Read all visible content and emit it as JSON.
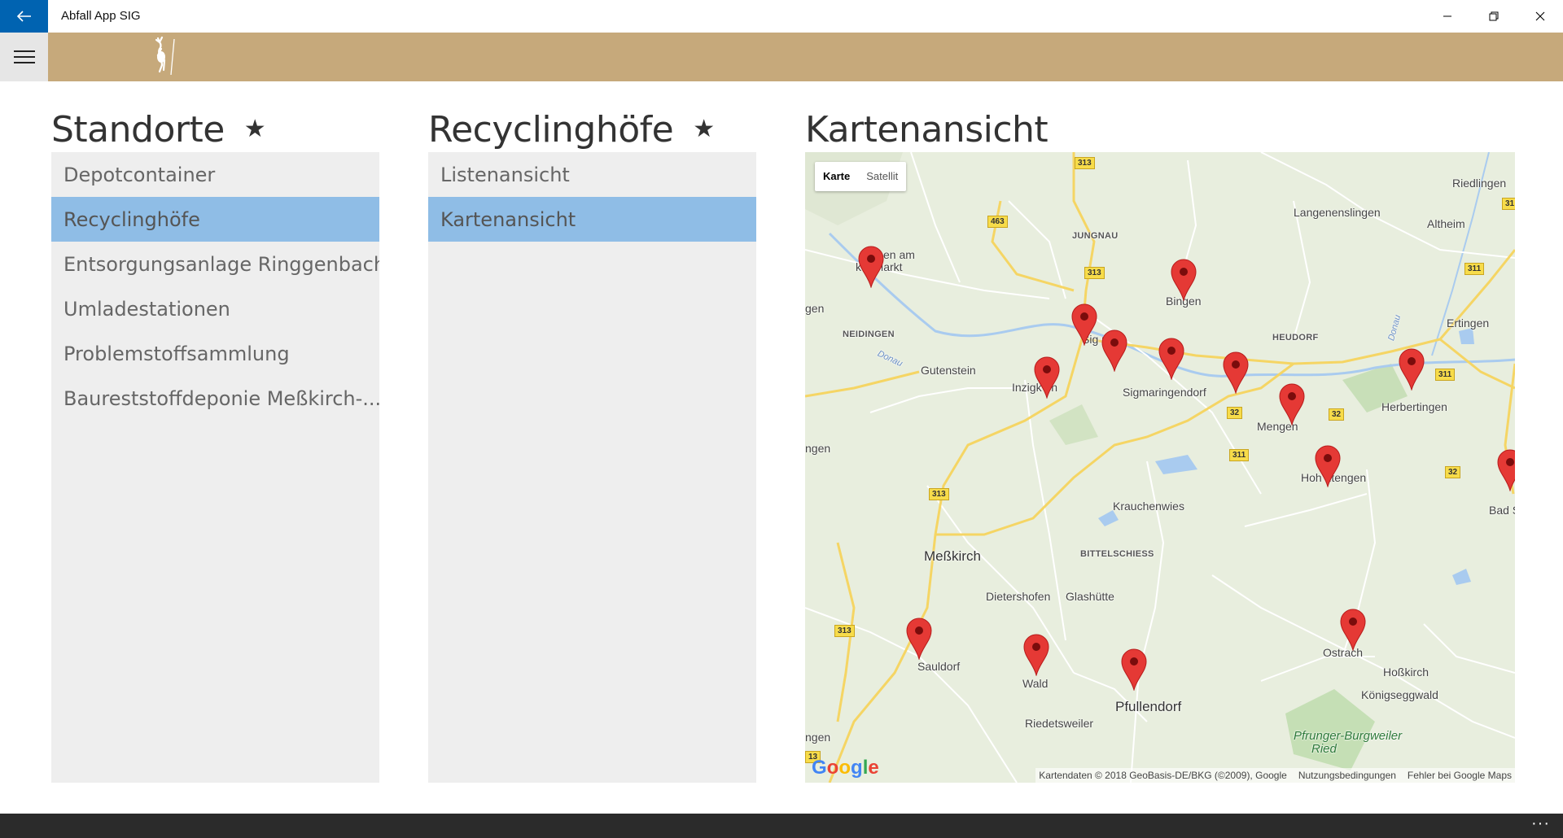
{
  "window": {
    "title": "Abfall App SIG",
    "accent": "#0063b1",
    "header_color": "#c6a97b"
  },
  "icons": {
    "back": "arrow-left-icon",
    "menu": "hamburger-icon",
    "minimize": "minimize-icon",
    "maximize": "restore-icon",
    "close": "close-icon",
    "more": "more-icon"
  },
  "columns": {
    "standorte": {
      "title": "Standorte",
      "star": "★",
      "items": [
        "Depotcontainer",
        "Recyclinghöfe",
        "Entsorgungsanlage Ringgenbach",
        "Umladestationen",
        "Problemstoffsammlung",
        "Baureststoffdeponie Meßkirch-..."
      ],
      "selected_index": 1
    },
    "recyclinghoefe": {
      "title": "Recyclinghöfe",
      "star": "★",
      "items": [
        "Listenansicht",
        "Kartenansicht"
      ],
      "selected_index": 1
    },
    "map": {
      "title": "Kartenansicht",
      "type_karte": "Karte",
      "type_satellit": "Satellit",
      "google": "Google",
      "attribution": "Kartendaten © 2018 GeoBasis-DE/BKG (©2009), Google",
      "terms": "Nutzungsbedingungen",
      "report": "Fehler bei Google Maps"
    }
  },
  "map_labels": {
    "riedlingen": "Riedlingen",
    "langenenslingen": "Langenenslingen",
    "altheim": "Altheim",
    "jungnau": "JUNGNAU",
    "bingen": "Bingen",
    "en_am": "en am",
    "k_markt": "k     n Markt",
    "gen1": "gen",
    "neidingen": "NEIDINGEN",
    "donau1": "Donau",
    "donau2": "Donau",
    "sigmaringen": "Sig    ngen",
    "heudorf": "HEUDORF",
    "ertingen": "Ertingen",
    "gutenstein": "Gutenstein",
    "inzigkofen": "Inzigk    en",
    "sigmaringendorf": "Sigmaringendorf",
    "herbertingen": "Herbertingen",
    "mengen": "Mengen",
    "ngen": "ngen",
    "hohentengen": "Hoh      ntengen",
    "krauchenwies": "Krauchenwies",
    "bad_s": "Bad S",
    "messkirch": "Meßkirch",
    "bittelschiess": "BITTELSCHIESS",
    "dietershofen": "Dietershofen",
    "glashuette": "Glashütte",
    "ostrach": "Ostrach",
    "sauldorf": "Sauldorf",
    "wald": "Wald",
    "hosskirch": "Hoßkirch",
    "koenigseggwald": "Königseggwald",
    "pfullendorf": "Pfullendorf",
    "riedetsweiler": "Riedetsweiler",
    "pfrunger": "Pfrunger-Burgweiler",
    "ried": "Ried",
    "ngen2": "ngen"
  },
  "road_shields": [
    "313",
    "463",
    "313",
    "311",
    "311",
    "32",
    "32",
    "311",
    "313",
    "313",
    "32",
    "31",
    "13"
  ],
  "markers": [
    "recycling-marker",
    "recycling-marker",
    "recycling-marker",
    "recycling-marker",
    "recycling-marker",
    "recycling-marker",
    "recycling-marker",
    "recycling-marker",
    "recycling-marker",
    "recycling-marker",
    "recycling-marker",
    "recycling-marker",
    "recycling-marker",
    "recycling-marker",
    "recycling-marker",
    "recycling-marker"
  ]
}
